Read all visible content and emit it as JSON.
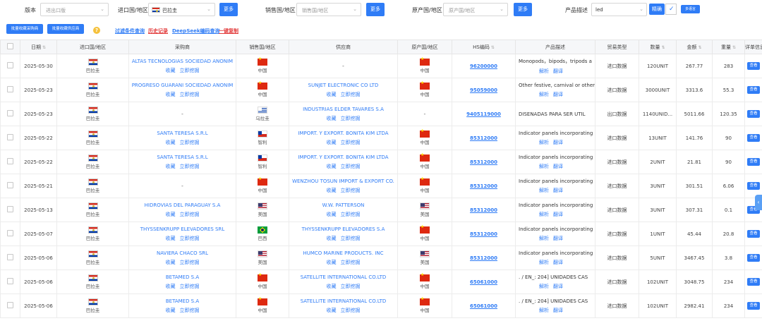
{
  "filters": {
    "version_label": "版本",
    "version_placeholder": "进出口版",
    "import_country_label": "进口国/地区",
    "import_country_value": "巴拉圭",
    "sales_country_label": "销售国/地区",
    "sales_country_placeholder": "销售国/地区",
    "origin_country_label": "原产国/地区",
    "origin_country_placeholder": "原产国/地区",
    "more_label": "更多",
    "product_desc_label": "产品描述",
    "product_desc_value": "led",
    "exact_label": "精确",
    "multi_lang_label": "多语言"
  },
  "actions": {
    "batch_buyer": "批量收藏采购商",
    "batch_supplier": "批量收藏供应商",
    "filter_query": "过滤条件查询",
    "history": "历史记录",
    "deepseek": "DeepSeek编码查询",
    "copy_all": "一键复制"
  },
  "table": {
    "headers": {
      "date": "日期",
      "import_country": "进口国/地区",
      "buyer": "采购商",
      "sales_country": "销售国/地区",
      "supplier": "供应商",
      "origin_country": "原产国/地区",
      "hs_code": "HS编码",
      "product_desc": "产品描述",
      "trade_type": "贸易类型",
      "quantity": "数量",
      "amount": "金额",
      "weight": "重量",
      "detail": "详单信息"
    },
    "sub_links": {
      "collect": "收藏",
      "mine": "立即挖掘",
      "analyze": "解析",
      "translate": "翻译",
      "view": "查看"
    },
    "rows": [
      {
        "date": "2025-05-30",
        "imp_country": "巴拉圭",
        "buyer": "ALTAS TECNOLOGIAS SOCIEDAD ANONIM",
        "sales_country": "中国",
        "supplier": "-",
        "origin_country": "中国",
        "hs": "96200000",
        "desc": "Monopods，bipods，tripods a",
        "trade_type": "进口数据",
        "qty": "120UNIT",
        "amount": "267.77",
        "weight": "283"
      },
      {
        "date": "2025-05-23",
        "imp_country": "巴拉圭",
        "buyer": "PROGRESO GUARANI SOCIEDAD ANONIM",
        "sales_country": "中国",
        "supplier": "SUNJET ELECTRONIC CO LTD",
        "origin_country": "中国",
        "hs": "95059000",
        "desc": "Other festive, carnival or other",
        "trade_type": "进口数据",
        "qty": "3000UNIT",
        "amount": "3313.6",
        "weight": "55.3"
      },
      {
        "date": "2025-05-23",
        "imp_country": "巴拉圭",
        "buyer": "-",
        "sales_country": "乌拉圭",
        "supplier": "INDUSTRIAS ELDER TAVARES S.A",
        "origin_country": "-",
        "hs": "9405119000",
        "desc": "DISENADAS PARA SER UTIL",
        "trade_type": "出口数据",
        "qty": "1140UNID...",
        "amount": "5011.66",
        "weight": "120.35"
      },
      {
        "date": "2025-05-22",
        "imp_country": "巴拉圭",
        "buyer": "SANTA TERESA S.R.L",
        "sales_country": "智利",
        "supplier": "IMPORT. Y EXPORT. BONITA KIM LTDA",
        "origin_country": "中国",
        "hs": "85312000",
        "desc": "Indicator panels incorporating",
        "trade_type": "进口数据",
        "qty": "13UNIT",
        "amount": "141.76",
        "weight": "90"
      },
      {
        "date": "2025-05-22",
        "imp_country": "巴拉圭",
        "buyer": "SANTA TERESA S.R.L",
        "sales_country": "智利",
        "supplier": "IMPORT. Y EXPORT. BONITA KIM LTDA",
        "origin_country": "中国",
        "hs": "85312000",
        "desc": "Indicator panels incorporating",
        "trade_type": "进口数据",
        "qty": "2UNIT",
        "amount": "21.81",
        "weight": "90"
      },
      {
        "date": "2025-05-21",
        "imp_country": "巴拉圭",
        "buyer": "-",
        "sales_country": "中国",
        "supplier": "WENZHOU TOSUN IMPORT & EXPORT CO.",
        "origin_country": "中国",
        "hs": "85312000",
        "desc": "Indicator panels incorporating",
        "trade_type": "进口数据",
        "qty": "3UNIT",
        "amount": "301.51",
        "weight": "6.06"
      },
      {
        "date": "2025-05-13",
        "imp_country": "巴拉圭",
        "buyer": "HIDROVIAS DEL PARAGUAY S.A",
        "sales_country": "美国",
        "supplier": "W.W. PATTERSON",
        "origin_country": "美国",
        "hs": "85312000",
        "desc": "Indicator panels incorporating",
        "trade_type": "进口数据",
        "qty": "3UNIT",
        "amount": "307.31",
        "weight": "0.1"
      },
      {
        "date": "2025-05-07",
        "imp_country": "巴拉圭",
        "buyer": "THYSSENKRUPP ELEVADORES SRL",
        "sales_country": "巴西",
        "supplier": "THYSSENKRUPP ELEVADORES S.A",
        "origin_country": "中国",
        "hs": "85312000",
        "desc": "Indicator panels incorporating",
        "trade_type": "进口数据",
        "qty": "1UNIT",
        "amount": "45.44",
        "weight": "20.8"
      },
      {
        "date": "2025-05-06",
        "imp_country": "巴拉圭",
        "buyer": "NAVIERA CHACO SRL",
        "sales_country": "美国",
        "supplier": "HUMCO MARINE PRODUCTS. INC",
        "origin_country": "美国",
        "hs": "85312000",
        "desc": "Indicator panels incorporating",
        "trade_type": "进口数据",
        "qty": "5UNIT",
        "amount": "3467.45",
        "weight": "3.8"
      },
      {
        "date": "2025-05-06",
        "imp_country": "巴拉圭",
        "buyer": "BETAMED S.A",
        "sales_country": "中国",
        "supplier": "SATELLITE INTERNATIONAL CO.LTD",
        "origin_country": "中国",
        "hs": "65061000",
        "desc": ". / EN_: 204] UNIDADES CAS",
        "trade_type": "进口数据",
        "qty": "102UNIT",
        "amount": "3048.75",
        "weight": "234"
      },
      {
        "date": "2025-05-06",
        "imp_country": "巴拉圭",
        "buyer": "BETAMED S.A",
        "sales_country": "中国",
        "supplier": "SATELLITE INTERNATIONAL CO.LTD",
        "origin_country": "中国",
        "hs": "65061000",
        "desc": ". / EN_: 204] UNIDADES CAS",
        "trade_type": "进口数据",
        "qty": "102UNIT",
        "amount": "2982.41",
        "weight": "234"
      }
    ]
  }
}
